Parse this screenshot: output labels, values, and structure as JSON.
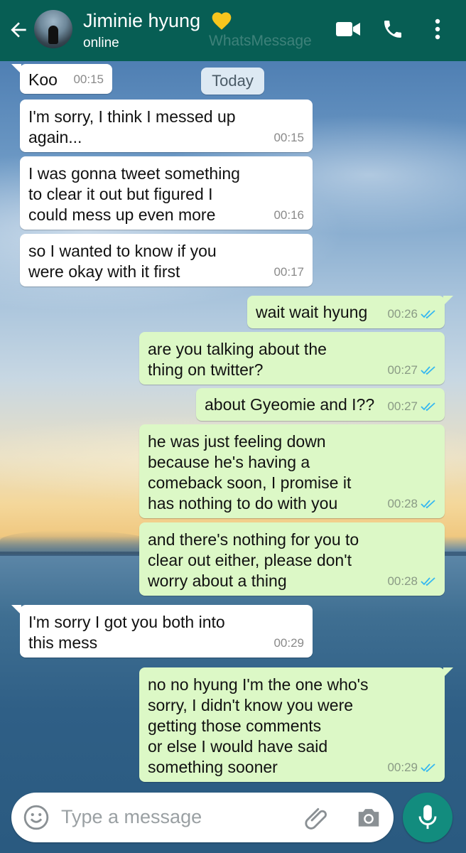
{
  "header": {
    "contact_name": "Jiminie hyung",
    "status": "online",
    "watermark": "WhatsMessage",
    "heart_color": "#f7c51d",
    "header_color": "#075e54"
  },
  "date_chip": "Today",
  "messages": [
    {
      "dir": "in",
      "text": "Koo",
      "time": "00:15"
    },
    {
      "dir": "in",
      "text": "I'm sorry, I think I messed up\nagain...",
      "time": "00:15"
    },
    {
      "dir": "in",
      "text": "I was gonna tweet something\nto clear it out but figured I\ncould mess up even more",
      "time": "00:16"
    },
    {
      "dir": "in",
      "text": "so I wanted to know if you\nwere okay with it first",
      "time": "00:17"
    },
    {
      "dir": "out",
      "text": "wait wait hyung",
      "time": "00:26",
      "read": true
    },
    {
      "dir": "out",
      "text": "are you talking about the\nthing on twitter?",
      "time": "00:27",
      "read": true
    },
    {
      "dir": "out",
      "text": "about Gyeomie and I??",
      "time": "00:27",
      "read": true
    },
    {
      "dir": "out",
      "text": "he was just feeling down\nbecause he's having a\ncomeback soon, I promise it\nhas nothing to do with you",
      "time": "00:28",
      "read": true
    },
    {
      "dir": "out",
      "text": "and there's nothing for you to\nclear out either, please don't\nworry about a thing",
      "time": "00:28",
      "read": true
    },
    {
      "dir": "in",
      "text": "I'm sorry I got you both into\nthis mess",
      "time": "00:29"
    },
    {
      "dir": "out",
      "text": "no no hyung I'm the one who's\nsorry, I didn't know you were\ngetting those comments\nor else I would have said\nsomething sooner",
      "time": "00:29",
      "read": true
    }
  ],
  "composer": {
    "placeholder": "Type a message"
  },
  "icons": {
    "back": "arrow-left-icon",
    "video": "video-camera-icon",
    "call": "phone-icon",
    "menu": "more-vertical-icon",
    "emoji": "smiley-icon",
    "attach": "paperclip-icon",
    "camera": "camera-icon",
    "mic": "microphone-icon",
    "read_ticks": "double-check-icon",
    "tick_color": "#34b7f1"
  }
}
